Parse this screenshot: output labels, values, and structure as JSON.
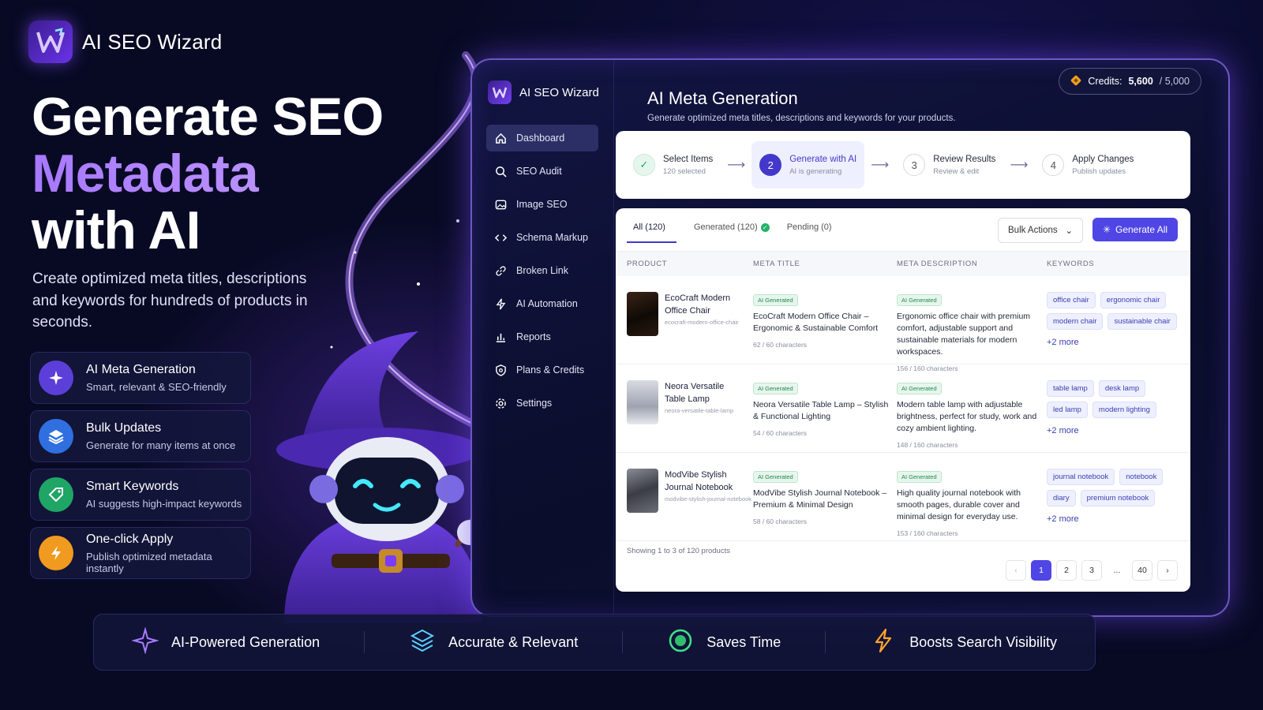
{
  "brand": {
    "name": "AI SEO Wizard",
    "logo_icon": "wizard-w-logo"
  },
  "hero": {
    "line1": "Generate SEO",
    "line2": "Metadata",
    "line3": "with AI",
    "subtext": "Create optimized meta titles, descriptions and keywords for hundreds of products in seconds."
  },
  "features": [
    {
      "title": "AI Meta Generation",
      "desc": "Smart, relevant & SEO-friendly",
      "icon": "sparkles-icon",
      "color": "#5b3fd8"
    },
    {
      "title": "Bulk Updates",
      "desc": "Generate for many items at once",
      "icon": "layers-icon",
      "color": "#2f6fe0"
    },
    {
      "title": "Smart Keywords",
      "desc": "AI suggests high-impact keywords",
      "icon": "tag-icon",
      "color": "#1fa566"
    },
    {
      "title": "One-click Apply",
      "desc": "Publish optimized metadata instantly",
      "icon": "lightning-icon",
      "color": "#f09a1f"
    }
  ],
  "app": {
    "brand": "AI SEO Wizard",
    "nav": [
      {
        "label": "Dashboard",
        "icon": "home-icon",
        "active": true
      },
      {
        "label": "SEO Audit",
        "icon": "search-icon"
      },
      {
        "label": "Image SEO",
        "icon": "image-icon"
      },
      {
        "label": "Schema Markup",
        "icon": "code-icon"
      },
      {
        "label": "Broken Link",
        "icon": "link-icon"
      },
      {
        "label": "AI Automation",
        "icon": "lightning-icon"
      },
      {
        "label": "Reports",
        "icon": "bar-chart-icon"
      },
      {
        "label": "Plans & Credits",
        "icon": "shield-icon"
      },
      {
        "label": "Settings",
        "icon": "gear-icon"
      }
    ],
    "title": "AI Meta Generation",
    "subtitle": "Generate optimized meta titles, descriptions and keywords for your products.",
    "credits": {
      "label": "Credits:",
      "value": "5,600",
      "total": "/ 5,000"
    },
    "steps": [
      {
        "num": "✓",
        "label": "Select Items",
        "sub": "120 selected",
        "state": "done"
      },
      {
        "num": "2",
        "label": "Generate with AI",
        "sub": "AI is generating",
        "state": "active"
      },
      {
        "num": "3",
        "label": "Review Results",
        "sub": "Review & edit",
        "state": "todo"
      },
      {
        "num": "4",
        "label": "Apply Changes",
        "sub": "Publish updates",
        "state": "todo"
      }
    ],
    "tabs": {
      "all": "All (120)",
      "generated": "Generated (120)",
      "pending": "Pending (0)"
    },
    "bulk_actions": "Bulk Actions",
    "generate_all": "Generate All",
    "columns": [
      "PRODUCT",
      "META TITLE",
      "META DESCRIPTION",
      "KEYWORDS"
    ],
    "badge": "AI Generated",
    "rows": [
      {
        "name": "EcoCraft Modern Office Chair",
        "slug": "ecocraft-modern-office-chair",
        "title": "EcoCraft Modern Office Chair – Ergonomic & Sustainable Comfort",
        "title_count": "62 / 60 characters",
        "desc": "Ergonomic office chair with premium comfort, adjustable support and sustainable materials for modern workspaces.",
        "desc_count": "156 / 160 characters",
        "keywords": [
          "office chair",
          "ergonomic chair",
          "modern chair",
          "sustainable chair"
        ],
        "more": "+2 more"
      },
      {
        "name": "Neora Versatile Table Lamp",
        "slug": "neora-versatile-table-lamp",
        "title": "Neora Versatile Table Lamp – Stylish & Functional Lighting",
        "title_count": "54 / 60 characters",
        "desc": "Modern table lamp with adjustable brightness, perfect for study, work and cozy ambient lighting.",
        "desc_count": "148 / 160 characters",
        "keywords": [
          "table lamp",
          "desk lamp",
          "led lamp",
          "modern lighting"
        ],
        "more": "+2 more"
      },
      {
        "name": "ModVibe Stylish Journal Notebook",
        "slug": "modvibe-stylish-journal-notebook",
        "title": "ModVibe Stylish Journal Notebook – Premium & Minimal Design",
        "title_count": "58 / 60 characters",
        "desc": "High quality journal notebook with smooth pages, durable cover and minimal design for everyday use.",
        "desc_count": "153 / 160 characters",
        "keywords": [
          "journal notebook",
          "notebook",
          "diary",
          "premium notebook"
        ],
        "more": "+2 more"
      }
    ],
    "showing": "Showing 1 to 3 of 120 products",
    "pages": [
      "1",
      "2",
      "3",
      "...",
      "40"
    ]
  },
  "benefits": [
    {
      "label": "AI-Powered Generation",
      "icon": "sparkle-icon"
    },
    {
      "label": "Accurate & Relevant",
      "icon": "layers-icon"
    },
    {
      "label": "Saves Time",
      "icon": "clock-icon"
    },
    {
      "label": "Boosts Search Visibility",
      "icon": "lightning-icon"
    }
  ]
}
